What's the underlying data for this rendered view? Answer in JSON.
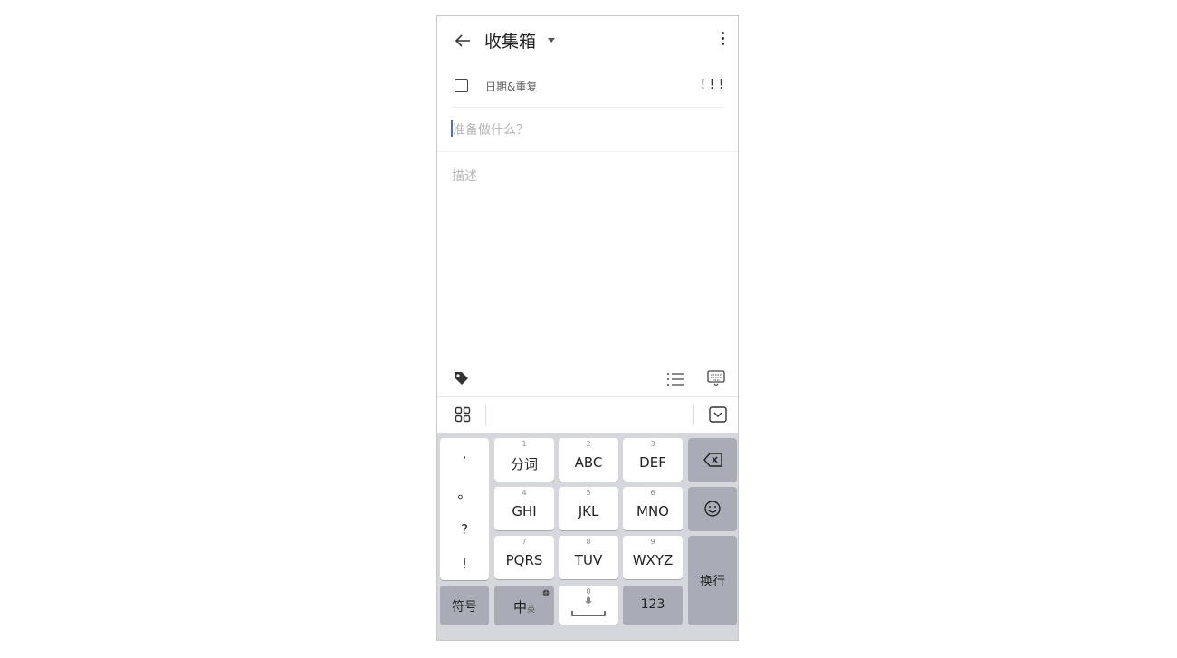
{
  "header": {
    "title": "收集箱"
  },
  "task": {
    "date_label": "日期&重复",
    "priority_label": "!!!",
    "title_placeholder": "准备做什么？",
    "description_placeholder": "描述"
  },
  "keyboard": {
    "punctuation": [
      ",",
      "。",
      "?",
      "!"
    ],
    "keys": [
      {
        "num": "1",
        "label": "分词"
      },
      {
        "num": "2",
        "label": "ABC"
      },
      {
        "num": "3",
        "label": "DEF"
      },
      {
        "num": "4",
        "label": "GHI"
      },
      {
        "num": "5",
        "label": "JKL"
      },
      {
        "num": "6",
        "label": "MNO"
      },
      {
        "num": "7",
        "label": "PQRS"
      },
      {
        "num": "8",
        "label": "TUV"
      },
      {
        "num": "9",
        "label": "WXYZ"
      }
    ],
    "symbol_label": "符号",
    "lang_main": "中",
    "lang_sub": "英",
    "space_num": "0",
    "numeric_label": "123",
    "enter_label": "换行"
  },
  "colors": {
    "cursor": "#4b6cd8",
    "keyboard_bg": "#d6d7dc",
    "dark_key": "#a9acb6"
  },
  "icons": [
    "back-arrow-icon",
    "dropdown-caret-icon",
    "more-vert-icon",
    "checkbox-icon",
    "tag-icon",
    "list-icon",
    "keyboard-icon",
    "grid-icon",
    "collapse-keyboard-icon",
    "backspace-icon",
    "emoji-icon",
    "mic-icon",
    "globe-icon"
  ]
}
